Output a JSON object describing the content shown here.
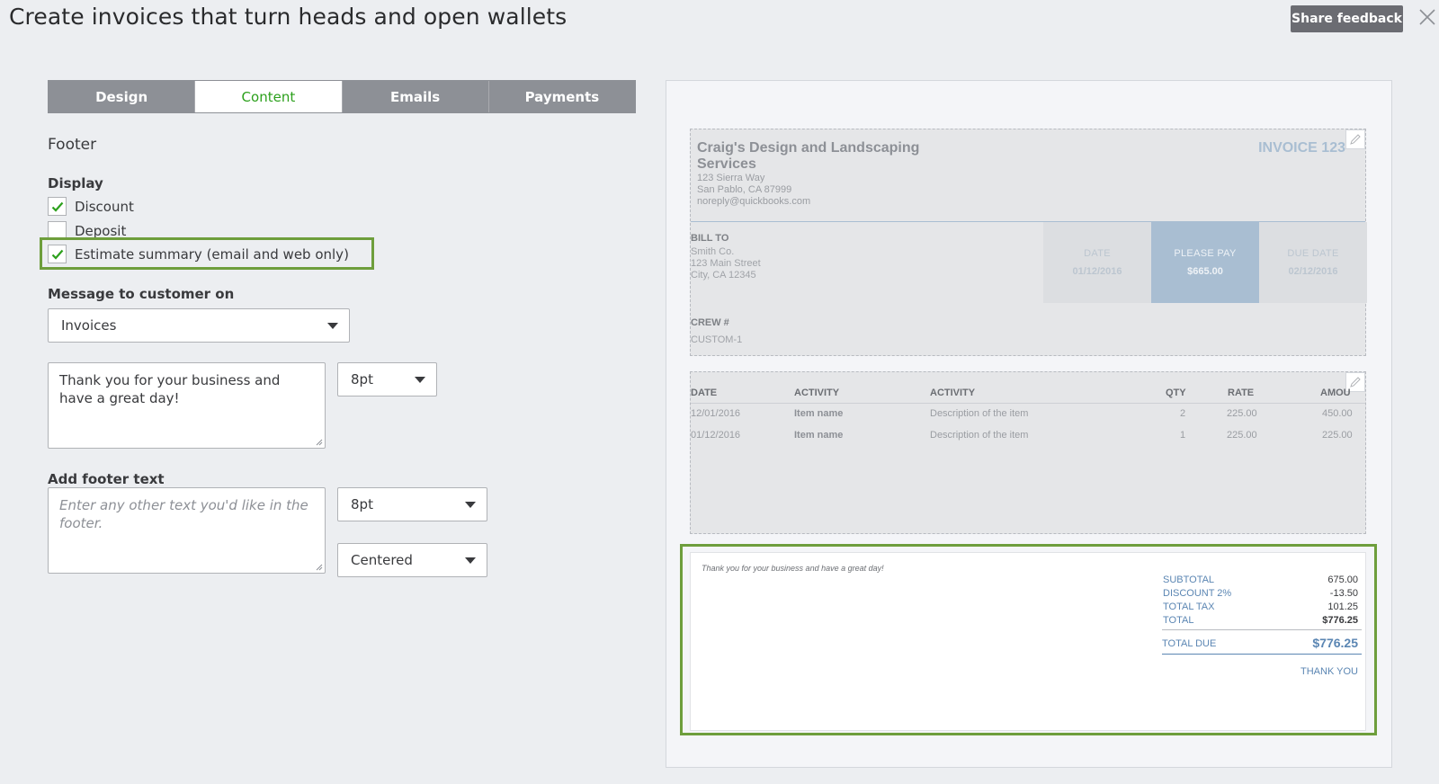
{
  "page": {
    "title": "Create invoices that turn heads and open wallets",
    "share_feedback": "Share feedback"
  },
  "tabs": [
    {
      "label": "Design",
      "active": false
    },
    {
      "label": "Content",
      "active": true
    },
    {
      "label": "Emails",
      "active": false
    },
    {
      "label": "Payments",
      "active": false
    }
  ],
  "footer_section": {
    "title": "Footer",
    "display_label": "Display",
    "options": [
      {
        "label": "Discount",
        "checked": true
      },
      {
        "label": "Deposit",
        "checked": false
      },
      {
        "label": "Estimate summary (email and web only)",
        "checked": true
      }
    ],
    "message_label": "Message to customer on",
    "message_on": "Invoices",
    "message_text": "Thank you for your business and have a great day!",
    "message_size": "8pt",
    "add_footer_label": "Add footer text",
    "footer_placeholder": "Enter any other text you'd like in the footer.",
    "footer_size": "8pt",
    "footer_alignment": "Centered"
  },
  "preview": {
    "company_name": "Craig's Design and Landscaping Services",
    "company_address": [
      "123 Sierra Way",
      "San Pablo, CA 87999",
      "noreply@quickbooks.com"
    ],
    "invoice_title": "INVOICE 123",
    "bill_to_label": "BILL TO",
    "bill_to_lines": [
      "Smith Co.",
      "123 Main Street",
      "City, CA 12345"
    ],
    "summary": [
      {
        "label": "DATE",
        "value": "01/12/2016",
        "highlight": false
      },
      {
        "label": "PLEASE PAY",
        "value": "$665.00",
        "highlight": true
      },
      {
        "label": "DUE DATE",
        "value": "02/12/2016",
        "highlight": false
      }
    ],
    "crew_label": "CREW #",
    "crew_value": "CUSTOM-1",
    "table_headers": [
      "DATE",
      "ACTIVITY",
      "ACTIVITY",
      "QTY",
      "RATE",
      "AMOU"
    ],
    "rows": [
      {
        "date": "12/01/2016",
        "item": "Item name",
        "desc": "Description of the item",
        "qty": "2",
        "rate": "225.00",
        "amount": "450.00"
      },
      {
        "date": "01/12/2016",
        "item": "Item name",
        "desc": "Description of the item",
        "qty": "1",
        "rate": "225.00",
        "amount": "225.00"
      }
    ],
    "footer_message": "Thank you for your business and have a great day!",
    "totals": [
      {
        "label": "SUBTOTAL",
        "value": "675.00"
      },
      {
        "label": "DISCOUNT 2%",
        "value": "-13.50"
      },
      {
        "label": "TOTAL TAX",
        "value": "101.25"
      },
      {
        "label": "TOTAL",
        "value": "$776.25"
      }
    ],
    "total_due_label": "TOTAL DUE",
    "total_due_value": "$776.25",
    "thank_you": "THANK YOU"
  },
  "colors": {
    "accent_green": "#2ca01c",
    "highlight_green": "#6e9e3c",
    "tab_gray": "#8d9096",
    "please_pay_blue": "#a9bed2"
  }
}
